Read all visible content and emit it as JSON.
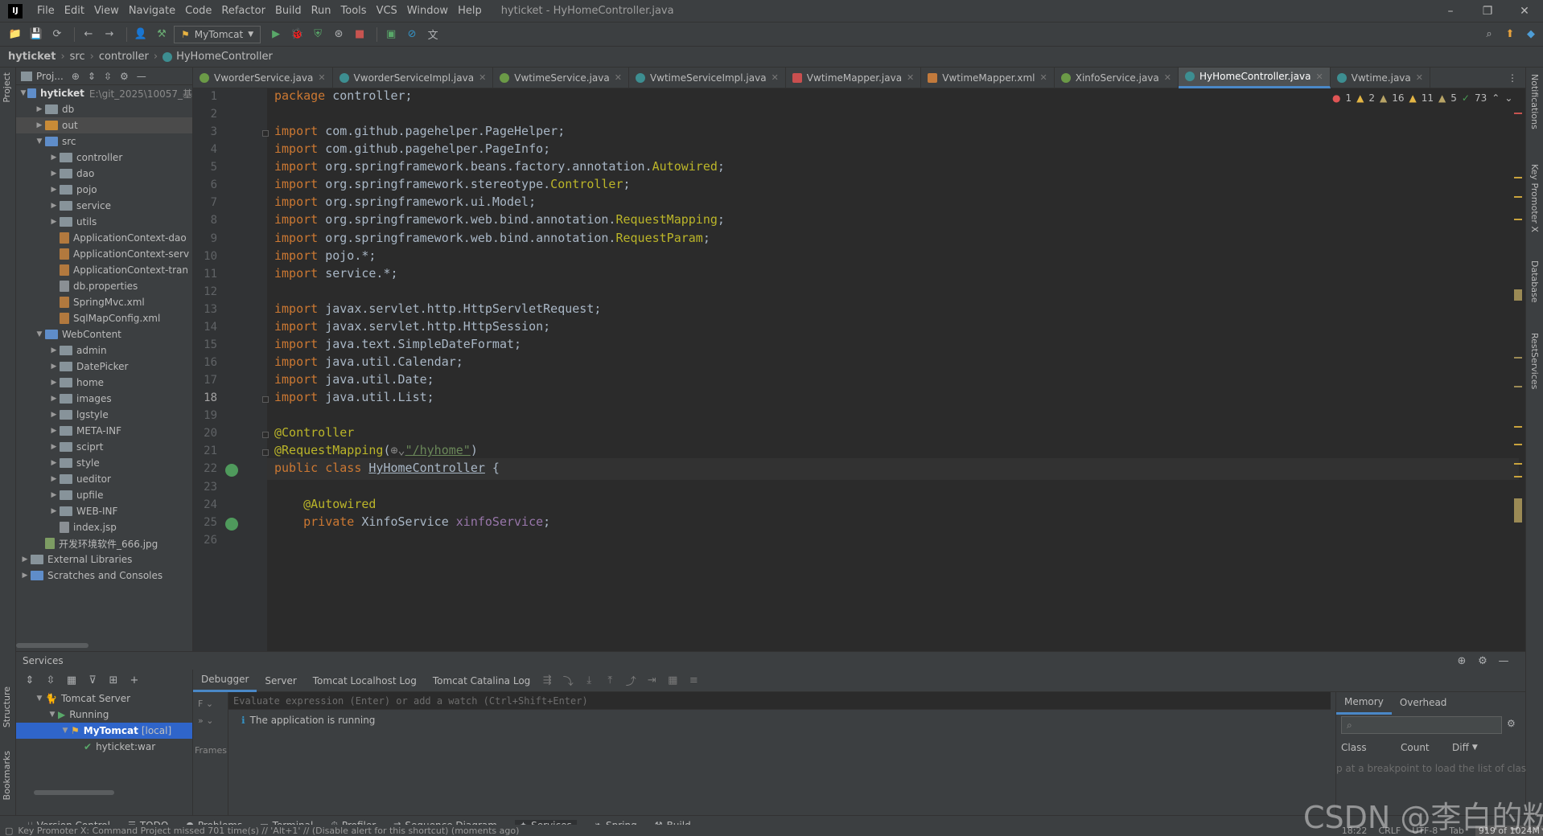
{
  "app": {
    "logo": "IJ",
    "window_title": "hyticket - HyHomeController.java"
  },
  "menu": [
    "File",
    "Edit",
    "View",
    "Navigate",
    "Code",
    "Refactor",
    "Build",
    "Run",
    "Tools",
    "VCS",
    "Window",
    "Help"
  ],
  "window_controls": {
    "minimize": "–",
    "restore": "❐",
    "close": "✕"
  },
  "toolbar": {
    "run_config": "MyTomcat"
  },
  "breadcrumb": [
    "hyticket",
    "src",
    "controller",
    "HyHomeController"
  ],
  "project_panel": {
    "title": "Proj...",
    "root": {
      "name": "hyticket",
      "path": "E:\\git_2025\\10057_基"
    },
    "tree": [
      {
        "label": "db",
        "level": 1,
        "kind": "folder"
      },
      {
        "label": "out",
        "level": 1,
        "kind": "folder-orange",
        "selected": true
      },
      {
        "label": "src",
        "level": 1,
        "kind": "folder-blue",
        "expanded": true
      },
      {
        "label": "controller",
        "level": 2,
        "kind": "folder"
      },
      {
        "label": "dao",
        "level": 2,
        "kind": "folder"
      },
      {
        "label": "pojo",
        "level": 2,
        "kind": "folder"
      },
      {
        "label": "service",
        "level": 2,
        "kind": "folder"
      },
      {
        "label": "utils",
        "level": 2,
        "kind": "folder"
      },
      {
        "label": "ApplicationContext-dao",
        "level": 2,
        "kind": "xml"
      },
      {
        "label": "ApplicationContext-serv",
        "level": 2,
        "kind": "xml"
      },
      {
        "label": "ApplicationContext-tran",
        "level": 2,
        "kind": "xml"
      },
      {
        "label": "db.properties",
        "level": 2,
        "kind": "file"
      },
      {
        "label": "SpringMvc.xml",
        "level": 2,
        "kind": "xml"
      },
      {
        "label": "SqlMapConfig.xml",
        "level": 2,
        "kind": "xml"
      },
      {
        "label": "WebContent",
        "level": 1,
        "kind": "folder-blue",
        "expanded": true
      },
      {
        "label": "admin",
        "level": 2,
        "kind": "folder"
      },
      {
        "label": "DatePicker",
        "level": 2,
        "kind": "folder"
      },
      {
        "label": "home",
        "level": 2,
        "kind": "folder"
      },
      {
        "label": "images",
        "level": 2,
        "kind": "folder"
      },
      {
        "label": "lgstyle",
        "level": 2,
        "kind": "folder"
      },
      {
        "label": "META-INF",
        "level": 2,
        "kind": "folder"
      },
      {
        "label": "sciprt",
        "level": 2,
        "kind": "folder"
      },
      {
        "label": "style",
        "level": 2,
        "kind": "folder"
      },
      {
        "label": "ueditor",
        "level": 2,
        "kind": "folder"
      },
      {
        "label": "upfile",
        "level": 2,
        "kind": "folder"
      },
      {
        "label": "WEB-INF",
        "level": 2,
        "kind": "folder"
      },
      {
        "label": "index.jsp",
        "level": 2,
        "kind": "file"
      },
      {
        "label": "开发环境软件_666.jpg",
        "level": 1,
        "kind": "img"
      },
      {
        "label": "External Libraries",
        "level": 0,
        "kind": "lib"
      },
      {
        "label": "Scratches and Consoles",
        "level": 0,
        "kind": "scratch"
      }
    ]
  },
  "editor_tabs": [
    {
      "label": "VworderService.java",
      "kind": "interface"
    },
    {
      "label": "VworderServiceImpl.java",
      "kind": "class"
    },
    {
      "label": "VwtimeService.java",
      "kind": "interface"
    },
    {
      "label": "VwtimeServiceImpl.java",
      "kind": "class"
    },
    {
      "label": "VwtimeMapper.java",
      "kind": "mapper"
    },
    {
      "label": "VwtimeMapper.xml",
      "kind": "xml"
    },
    {
      "label": "XinfoService.java",
      "kind": "interface"
    },
    {
      "label": "HyHomeController.java",
      "kind": "class",
      "active": true
    },
    {
      "label": "Vwtime.java",
      "kind": "class"
    }
  ],
  "inspections": {
    "errors": "1",
    "warnings": "2",
    "weak1": "16",
    "weak2": "11",
    "weak3": "5",
    "typos": "73"
  },
  "code_lines": [
    {
      "n": "1",
      "html": "<span class=\"kw\">package</span> controller;"
    },
    {
      "n": "2",
      "html": ""
    },
    {
      "n": "3",
      "html": "<span class=\"kw\">import</span> com.github.pagehelper.PageHelper;"
    },
    {
      "n": "4",
      "html": "<span class=\"kw\">import</span> com.github.pagehelper.PageInfo;"
    },
    {
      "n": "5",
      "html": "<span class=\"kw\">import</span> org.springframework.beans.factory.annotation.<span class=\"ann\">Autowired</span>;"
    },
    {
      "n": "6",
      "html": "<span class=\"kw\">import</span> org.springframework.stereotype.<span class=\"ann\">Controller</span>;"
    },
    {
      "n": "7",
      "html": "<span class=\"kw\">import</span> org.springframework.ui.Model;"
    },
    {
      "n": "8",
      "html": "<span class=\"kw\">import</span> org.springframework.web.bind.annotation.<span class=\"ann\">RequestMapping</span>;"
    },
    {
      "n": "9",
      "html": "<span class=\"kw\">import</span> org.springframework.web.bind.annotation.<span class=\"ann\">RequestParam</span>;"
    },
    {
      "n": "10",
      "html": "<span class=\"kw\">import</span> pojo.*;"
    },
    {
      "n": "11",
      "html": "<span class=\"kw\">import</span> service.*;"
    },
    {
      "n": "12",
      "html": ""
    },
    {
      "n": "13",
      "html": "<span class=\"kw\">import</span> javax.servlet.http.HttpServletRequest;"
    },
    {
      "n": "14",
      "html": "<span class=\"kw\">import</span> javax.servlet.http.HttpSession;"
    },
    {
      "n": "15",
      "html": "<span class=\"kw\">import</span> java.text.SimpleDateFormat;"
    },
    {
      "n": "16",
      "html": "<span class=\"kw\">import</span> java.util.Calendar;"
    },
    {
      "n": "17",
      "html": "<span class=\"kw\">import</span> java.util.Date;"
    },
    {
      "n": "18",
      "html": "<span class=\"kw\">import</span> java.util.List;",
      "current": true
    },
    {
      "n": "19",
      "html": ""
    },
    {
      "n": "20",
      "html": "<span class=\"ann\">@Controller</span>"
    },
    {
      "n": "21",
      "html": "<span class=\"ann\">@RequestMapping</span>(<span style=\"color:#888\">⊕⌄</span><span class=\"str\">\"/hyhome\"</span>)"
    },
    {
      "n": "22",
      "html": "<span class=\"kw\">public class</span> <span style=\"text-decoration:underline\">HyHomeController</span> {"
    },
    {
      "n": "23",
      "html": ""
    },
    {
      "n": "24",
      "html": "    <span class=\"ann\">@Autowired</span>"
    },
    {
      "n": "25",
      "html": "    <span class=\"kw\">private</span> XinfoService <span class=\"fld\">xinfoService</span>;"
    },
    {
      "n": "26",
      "html": ""
    }
  ],
  "services": {
    "title": "Services",
    "tree": [
      {
        "label": "Tomcat Server",
        "level": 0
      },
      {
        "label": "Running",
        "level": 1
      },
      {
        "label": "MyTomcat",
        "suffix": "[local]",
        "level": 2,
        "selected": true
      },
      {
        "label": "hyticket:war",
        "level": 3
      }
    ],
    "subtabs": [
      "Debugger",
      "Server",
      "Tomcat Localhost Log",
      "Tomcat Catalina Log"
    ],
    "eval_placeholder": "Evaluate expression (Enter) or add a watch (Ctrl+Shift+Enter)",
    "frames_label": "Frames",
    "status_message": "The application is running",
    "memory_tabs": [
      "Memory",
      "Overhead"
    ],
    "memory_columns": [
      "Class",
      "Count",
      "Diff"
    ],
    "memory_hint": "p at a breakpoint to load the list of clas"
  },
  "tool_windows": [
    "Version Control",
    "TODO",
    "Problems",
    "Terminal",
    "Profiler",
    "Sequence Diagram",
    "Services",
    "Spring",
    "Build"
  ],
  "left_vertical_tabs": [
    "Project",
    "Structure",
    "Bookmarks"
  ],
  "right_vertical_tabs": [
    "Notifications",
    "Key Promoter X",
    "Database",
    "RestServices"
  ],
  "status": {
    "message": "Key Promoter X: Command Project missed 701 time(s) // 'Alt+1' // (Disable alert for this shortcut) (moments ago)",
    "position": "18:22",
    "line_sep": "CRLF",
    "encoding": "UTF-8",
    "indent": "Tab",
    "memory": "919 of 1024M"
  },
  "watermark": "CSDN @李白的粉"
}
